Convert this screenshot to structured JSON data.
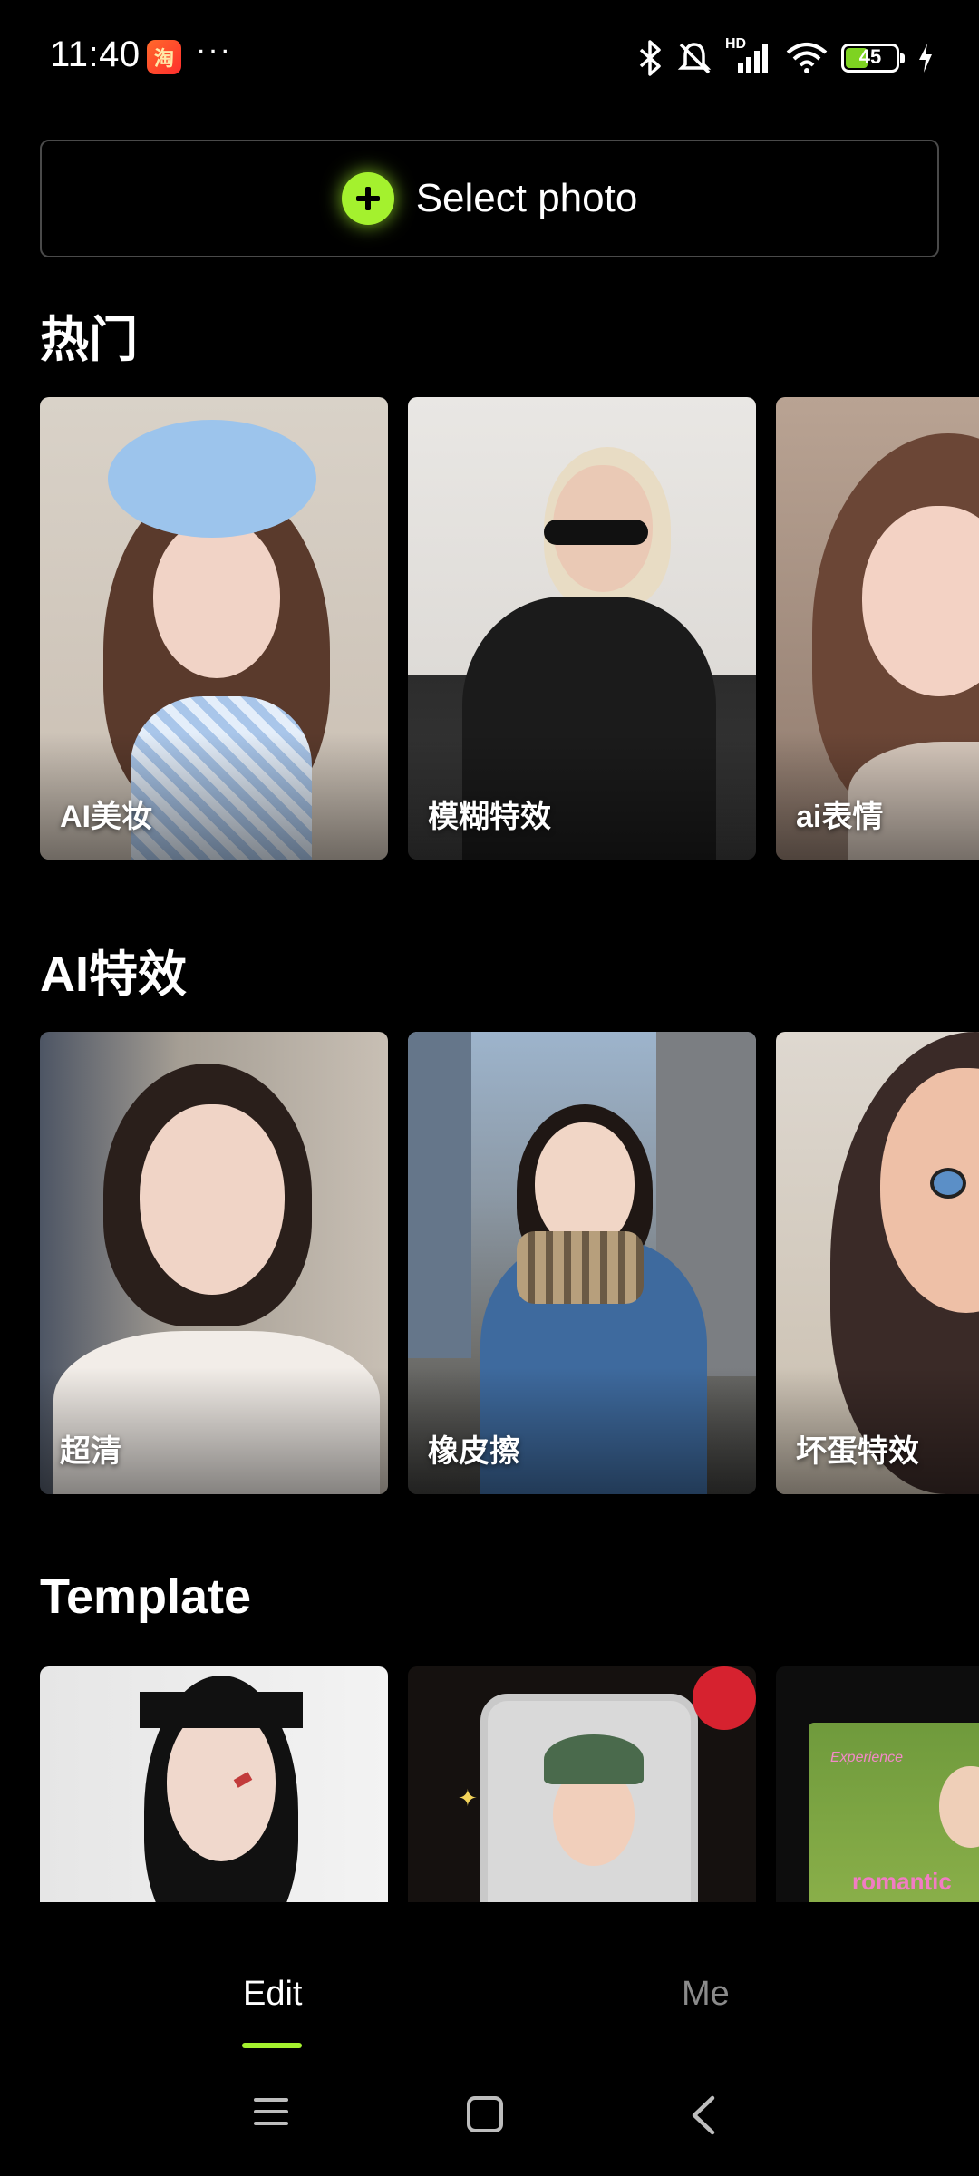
{
  "status_bar": {
    "time": "11:40",
    "app_badge": "淘",
    "more": "···",
    "network_label": "HD",
    "battery_level": "45"
  },
  "select_photo": {
    "label": "Select photo"
  },
  "sections": {
    "hot": {
      "title": "热门",
      "items": [
        {
          "label": "AI美妆"
        },
        {
          "label": "模糊特效"
        },
        {
          "label": "ai表情"
        }
      ]
    },
    "ai_effects": {
      "title": "AI特效",
      "items": [
        {
          "label": "超清"
        },
        {
          "label": "橡皮擦"
        },
        {
          "label": "坏蛋特效"
        }
      ]
    },
    "template": {
      "title": "Template",
      "items": [
        {
          "label": ""
        },
        {
          "label": ""
        },
        {
          "label": "romantic",
          "sub": "Experience"
        }
      ]
    }
  },
  "bottom_nav": {
    "tabs": [
      {
        "label": "Edit",
        "active": true
      },
      {
        "label": "Me",
        "active": false
      }
    ]
  },
  "colors": {
    "accent": "#a4f12e",
    "background": "#000000",
    "inactive": "#8a8a8a"
  }
}
